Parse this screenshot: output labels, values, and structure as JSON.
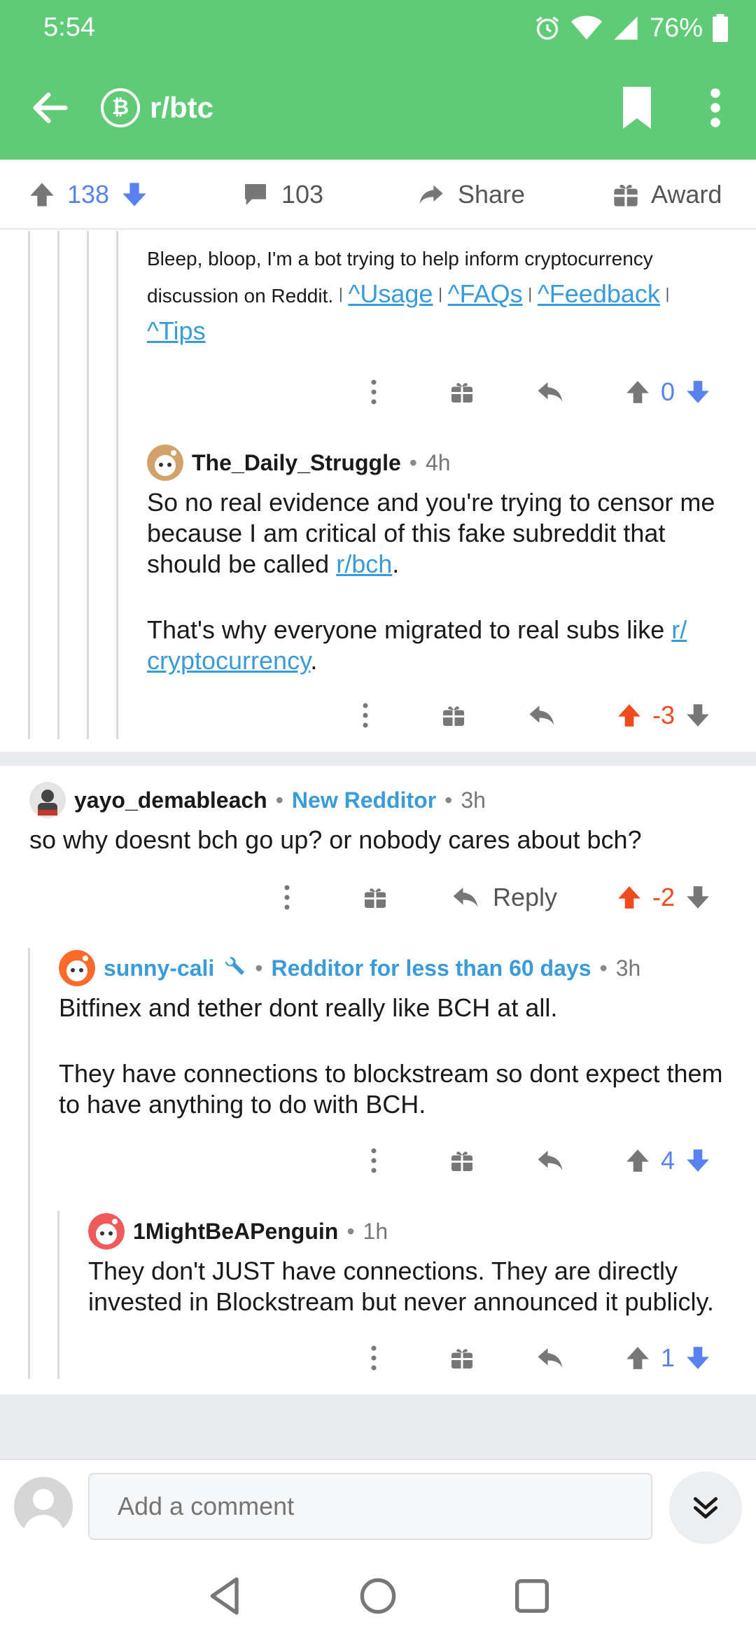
{
  "status": {
    "time": "5:54",
    "battery": "76%"
  },
  "header": {
    "title": "r/btc",
    "sub_icon_glyph": "₿",
    "bg_color": "#5fcb76"
  },
  "action_bar": {
    "score": "138",
    "comments": "103",
    "share_label": "Share",
    "award_label": "Award"
  },
  "bot_comment": {
    "text": "Bleep, bloop, I'm a bot trying to help inform cryptocurrency discussion on Reddit.",
    "pipe": "|",
    "links": [
      "^Usage",
      "^FAQs",
      "^Feedback",
      "^Tips"
    ],
    "score": "0"
  },
  "comment_daily": {
    "author": "The_Daily_Struggle",
    "dot": "•",
    "age": "4h",
    "p1_text": "So no real evidence and you're trying to censor me because I am critical of this fake subreddit that should be called",
    "p1_link": "r/bch",
    "p1_end": ".",
    "p2_text": "That's why everyone migrated to real subs like",
    "p2_link_1": "r/",
    "p2_link_2": "cryptocurrency",
    "p2_end": ".",
    "score": "-3"
  },
  "comment_yayo": {
    "author": "yayo_demableach",
    "dot": "•",
    "flair": "New Redditor",
    "age": "3h",
    "text": "so why doesnt bch go up? or nobody cares about bch?",
    "reply_label": "Reply",
    "score": "-2"
  },
  "comment_sunny": {
    "author": "sunny-cali",
    "dot": "•",
    "flair": "Redditor for less than 60 days",
    "age": "3h",
    "p1": "Bitfinex and tether dont really like BCH at all.",
    "p2": "They have connections to blockstream so dont expect them to have anything to do with BCH.",
    "score": "4"
  },
  "comment_penguin": {
    "author": "1MightBeAPenguin",
    "dot": "•",
    "age": "1h",
    "text": "They don't JUST have connections. They are directly invested in Blockstream but never announced it publicly.",
    "score": "1"
  },
  "comment_input": {
    "placeholder": "Add a comment"
  },
  "colors": {
    "upvote_blue": "#5a82ee",
    "downvote_red": "#ee4b1f",
    "link": "#3a9bd9"
  }
}
